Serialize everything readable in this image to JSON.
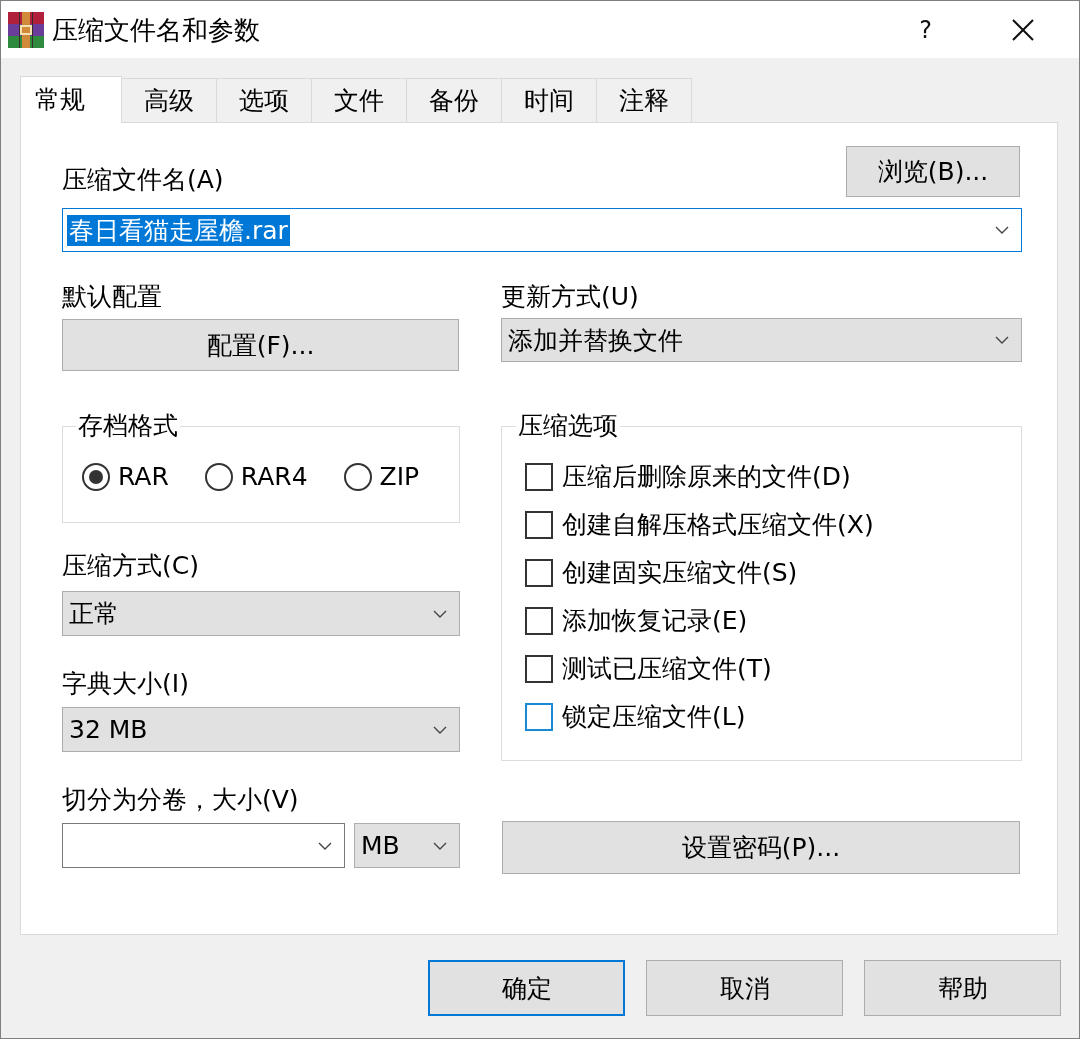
{
  "window": {
    "title": "压缩文件名和参数",
    "help_button": "?"
  },
  "tabs": [
    {
      "label": "常规",
      "selected": true
    },
    {
      "label": "高级",
      "selected": false
    },
    {
      "label": "选项",
      "selected": false
    },
    {
      "label": "文件",
      "selected": false
    },
    {
      "label": "备份",
      "selected": false
    },
    {
      "label": "时间",
      "selected": false
    },
    {
      "label": "注释",
      "selected": false
    }
  ],
  "archive_name": {
    "label": "压缩文件名(A)",
    "value": "春日看猫走屋檐.rar",
    "focused": true,
    "browse_button": "浏览(B)..."
  },
  "profiles": {
    "label": "默认配置",
    "button": "配置(F)..."
  },
  "update_mode": {
    "label": "更新方式(U)",
    "value": "添加并替换文件"
  },
  "archive_format": {
    "title": "存档格式",
    "options": [
      {
        "label": "RAR",
        "selected": true
      },
      {
        "label": "RAR4",
        "selected": false
      },
      {
        "label": "ZIP",
        "selected": false
      }
    ]
  },
  "compression_method": {
    "label": "压缩方式(C)",
    "value": "正常"
  },
  "dictionary_size": {
    "label": "字典大小(I)",
    "value": "32 MB"
  },
  "split_volumes": {
    "label": "切分为分卷，大小(V)",
    "unit": "MB"
  },
  "archiving_options": {
    "title": "压缩选项",
    "items": [
      {
        "label": "压缩后删除原来的文件(D)",
        "checked": false,
        "hovered": false
      },
      {
        "label": "创建自解压格式压缩文件(X)",
        "checked": false,
        "hovered": false
      },
      {
        "label": "创建固实压缩文件(S)",
        "checked": false,
        "hovered": false
      },
      {
        "label": "添加恢复记录(E)",
        "checked": false,
        "hovered": false
      },
      {
        "label": "测试已压缩文件(T)",
        "checked": false,
        "hovered": false
      },
      {
        "label": "锁定压缩文件(L)",
        "checked": false,
        "hovered": true
      }
    ]
  },
  "password_button": "设置密码(P)...",
  "buttons": [
    {
      "label": "确定",
      "default": true
    },
    {
      "label": "取消",
      "default": false
    },
    {
      "label": "帮助",
      "default": false
    }
  ]
}
